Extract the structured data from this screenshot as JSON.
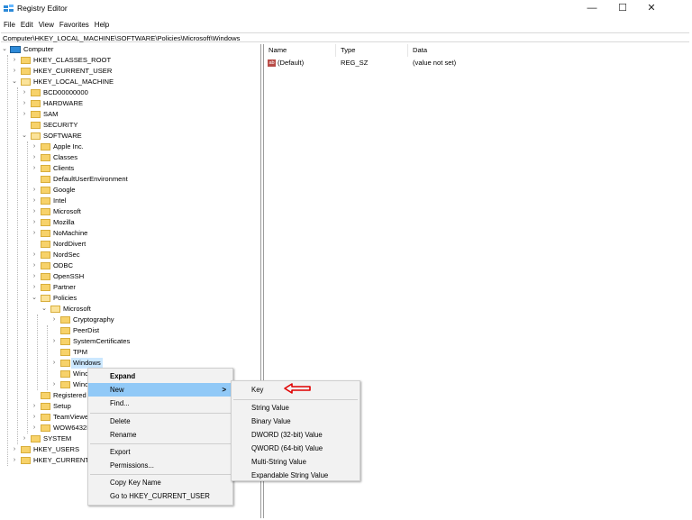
{
  "window": {
    "title": "Registry Editor",
    "controls": [
      "—",
      "☐",
      "✕"
    ]
  },
  "menu": [
    "File",
    "Edit",
    "View",
    "Favorites",
    "Help"
  ],
  "address": "Computer\\HKEY_LOCAL_MACHINE\\SOFTWARE\\Policies\\Microsoft\\Windows",
  "tree": {
    "computer": "Computer",
    "hkcr": "HKEY_CLASSES_ROOT",
    "hkcu": "HKEY_CURRENT_USER",
    "hklm": "HKEY_LOCAL_MACHINE",
    "bcd": "BCD00000000",
    "hardware": "HARDWARE",
    "sam": "SAM",
    "security": "SECURITY",
    "software": "SOFTWARE",
    "apple": "Apple Inc.",
    "classes": "Classes",
    "clients": "Clients",
    "default_user_env": "DefaultUserEnvironment",
    "google": "Google",
    "intel": "Intel",
    "microsoft": "Microsoft",
    "mozilla": "Mozilla",
    "nomachine": "NoMachine",
    "norddivert": "NordDivert",
    "nordsec": "NordSec",
    "odbc": "ODBC",
    "openssh": "OpenSSH",
    "partner": "Partner",
    "policies": "Policies",
    "policies_microsoft": "Microsoft",
    "cryptography": "Cryptography",
    "peerdist": "PeerDist",
    "system_certificates": "SystemCertificates",
    "tpm": "TPM",
    "windows": "Windows",
    "win1": "Winc",
    "win2": "Winc",
    "registered": "Registered",
    "setup": "Setup",
    "teamviewer": "TeamViewe",
    "wow64": "WOW6432I",
    "system": "SYSTEM",
    "hku": "HKEY_USERS",
    "hkcc": "HKEY_CURRENT_"
  },
  "list": {
    "columns": [
      "Name",
      "Type",
      "Data"
    ],
    "rows": [
      {
        "name": "(Default)",
        "type": "REG_SZ",
        "data": "(value not set)",
        "icon": "ab"
      }
    ]
  },
  "context_menu": {
    "items": [
      "Expand",
      "New",
      "Find...",
      "Delete",
      "Rename",
      "Export",
      "Permissions...",
      "Copy Key Name",
      "Go to HKEY_CURRENT_USER"
    ],
    "submenu_arrow": ">"
  },
  "new_submenu": {
    "items": [
      "Key",
      "String Value",
      "Binary Value",
      "DWORD (32-bit) Value",
      "QWORD (64-bit) Value",
      "Multi-String Value",
      "Expandable String Value"
    ]
  },
  "colors": {
    "selection": "#cce8ff",
    "menu_hover": "#91c9f7",
    "annotation_arrow": "#e00000"
  }
}
